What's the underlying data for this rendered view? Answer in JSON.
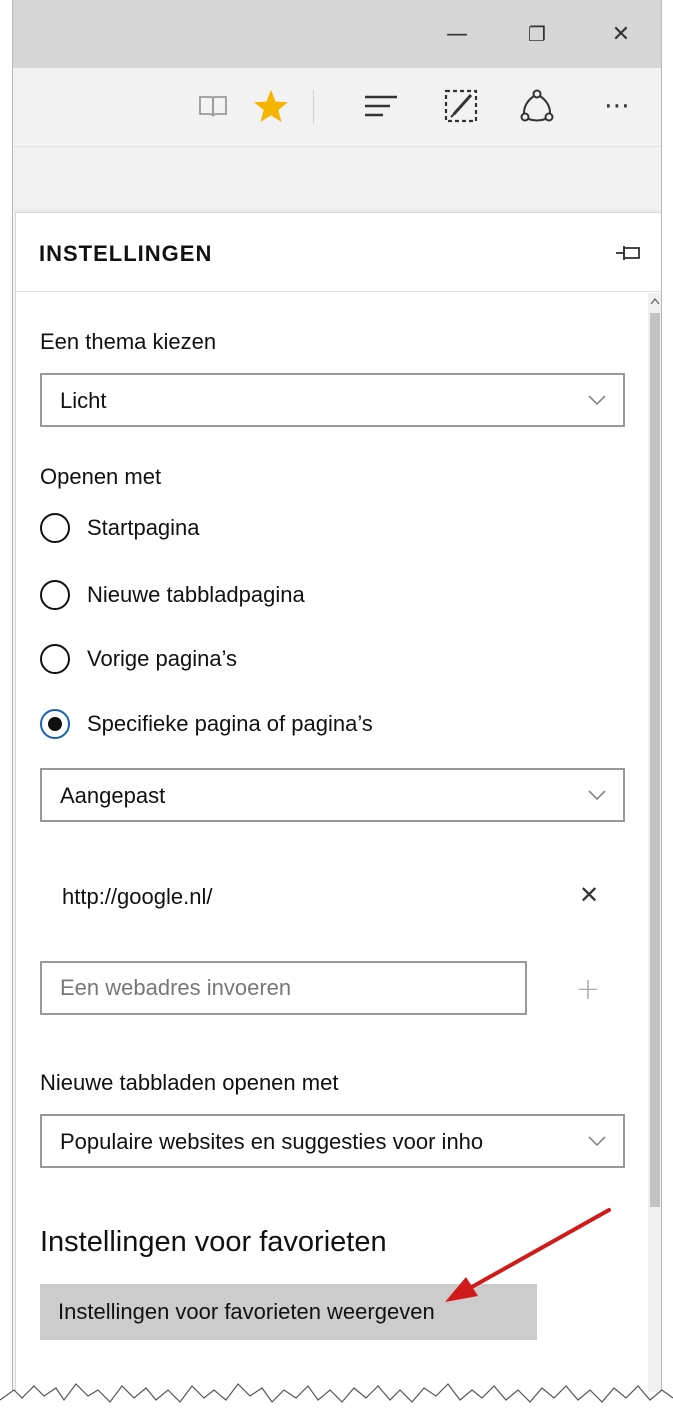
{
  "window": {
    "minimize_glyph": "—",
    "restore_glyph": "❐",
    "close_glyph": "✕"
  },
  "toolbar": {
    "icons": [
      "reading-view-icon",
      "favorite-star-icon",
      "hub-icon",
      "web-note-icon",
      "share-icon",
      "more-icon"
    ],
    "more_glyph": "⋯",
    "star_color": "#f4b400"
  },
  "panel": {
    "title": "INSTELLINGEN"
  },
  "theme": {
    "label": "Een thema kiezen",
    "value": "Licht"
  },
  "open_with": {
    "label": "Openen met",
    "options": [
      {
        "label": "Startpagina",
        "checked": false
      },
      {
        "label": "Nieuwe tabbladpagina",
        "checked": false
      },
      {
        "label": "Vorige pagina’s",
        "checked": false
      },
      {
        "label": "Specifieke pagina of pagina’s",
        "checked": true
      }
    ],
    "custom_value": "Aangepast"
  },
  "urls": {
    "items": [
      "http://google.nl/"
    ],
    "remove_glyph": "✕",
    "input_placeholder": "Een webadres invoeren",
    "add_glyph": "+"
  },
  "new_tabs": {
    "label": "Nieuwe tabbladen openen met",
    "value": "Populaire websites en suggesties voor inho"
  },
  "favorites": {
    "heading": "Instellingen voor favorieten",
    "button_label": "Instellingen voor favorieten weergeven"
  },
  "colors": {
    "accent": "#1a5fb4",
    "annotation_arrow": "#d11a1a"
  }
}
